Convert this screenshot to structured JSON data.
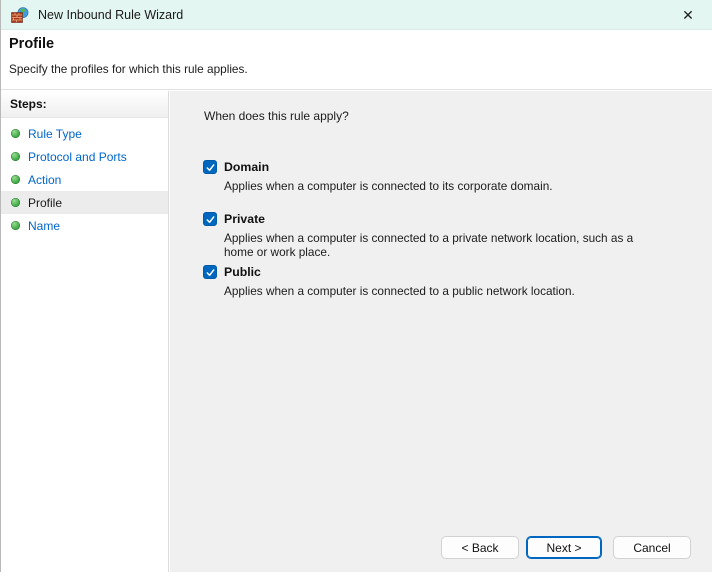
{
  "window": {
    "title": "New Inbound Rule Wizard",
    "close_glyph": "✕"
  },
  "header": {
    "title": "Profile",
    "subtitle": "Specify the profiles for which this rule applies."
  },
  "sidebar": {
    "heading": "Steps:",
    "items": [
      {
        "label": "Rule Type",
        "active": false
      },
      {
        "label": "Protocol and Ports",
        "active": false
      },
      {
        "label": "Action",
        "active": false
      },
      {
        "label": "Profile",
        "active": true
      },
      {
        "label": "Name",
        "active": false
      }
    ]
  },
  "main": {
    "question": "When does this rule apply?",
    "profiles": [
      {
        "label": "Domain",
        "checked": true,
        "description": "Applies when a computer is connected to its corporate domain."
      },
      {
        "label": "Private",
        "checked": true,
        "description": "Applies when a computer is connected to a private network location, such as a home or work place."
      },
      {
        "label": "Public",
        "checked": true,
        "description": "Applies when a computer is connected to a public network location."
      }
    ]
  },
  "buttons": {
    "back": "< Back",
    "next": "Next >",
    "cancel": "Cancel"
  },
  "colors": {
    "titlebar_bg": "#e3f6f1",
    "accent_blue": "#0067c0",
    "link_blue": "#0066cc",
    "panel_gray": "#f0f0f0",
    "bullet_green": "#2f9e38"
  }
}
